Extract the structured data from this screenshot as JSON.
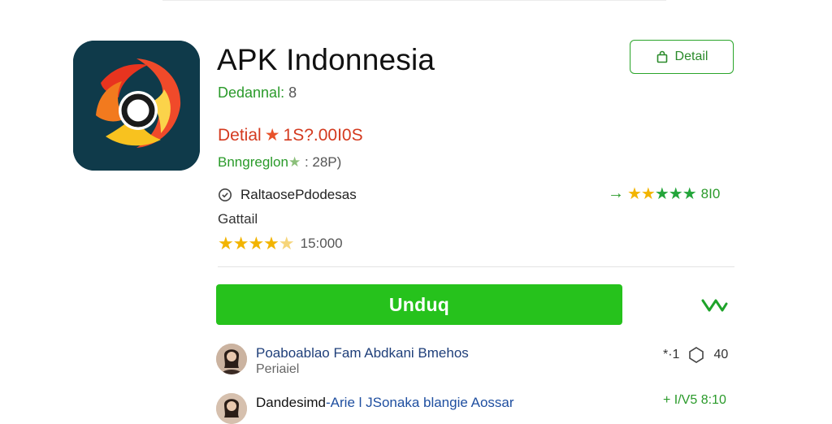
{
  "app": {
    "title": "APK Indonnesia",
    "subtitle_label": "Dedannal:",
    "subtitle_value": "8",
    "detail_label": "Detial",
    "detail_value": "1S?.00I0S",
    "size_label": "Bnngreglon",
    "size_value": ": 28P)",
    "developer": "RaltaosePdodesas",
    "section_label": "Gattail",
    "rating_value": "15:000",
    "rating_stars": 4.5,
    "side_rating_value": "8I0",
    "detail_button_label": "Detail",
    "download_button_label": "Unduq"
  },
  "reviews": [
    {
      "name": "Poaboablao Fam Abdkani Bmehos",
      "sub": "Periaiel",
      "meta_prefix": "*·1",
      "meta_value": "40"
    },
    {
      "name_prefix": "Dandesimd",
      "name_link": "-Arie l JSonaka blangie Aossar",
      "meta_value": "+ I/V5 8:10"
    }
  ],
  "colors": {
    "accent_green": "#26c21c",
    "title_red": "#d43a1f",
    "icon_bg": "#0f3a4a"
  },
  "icons": [
    "app-logo-icon",
    "bag-icon",
    "shield-check-icon",
    "share-icon",
    "hexagon-icon",
    "arrow-right-icon"
  ]
}
